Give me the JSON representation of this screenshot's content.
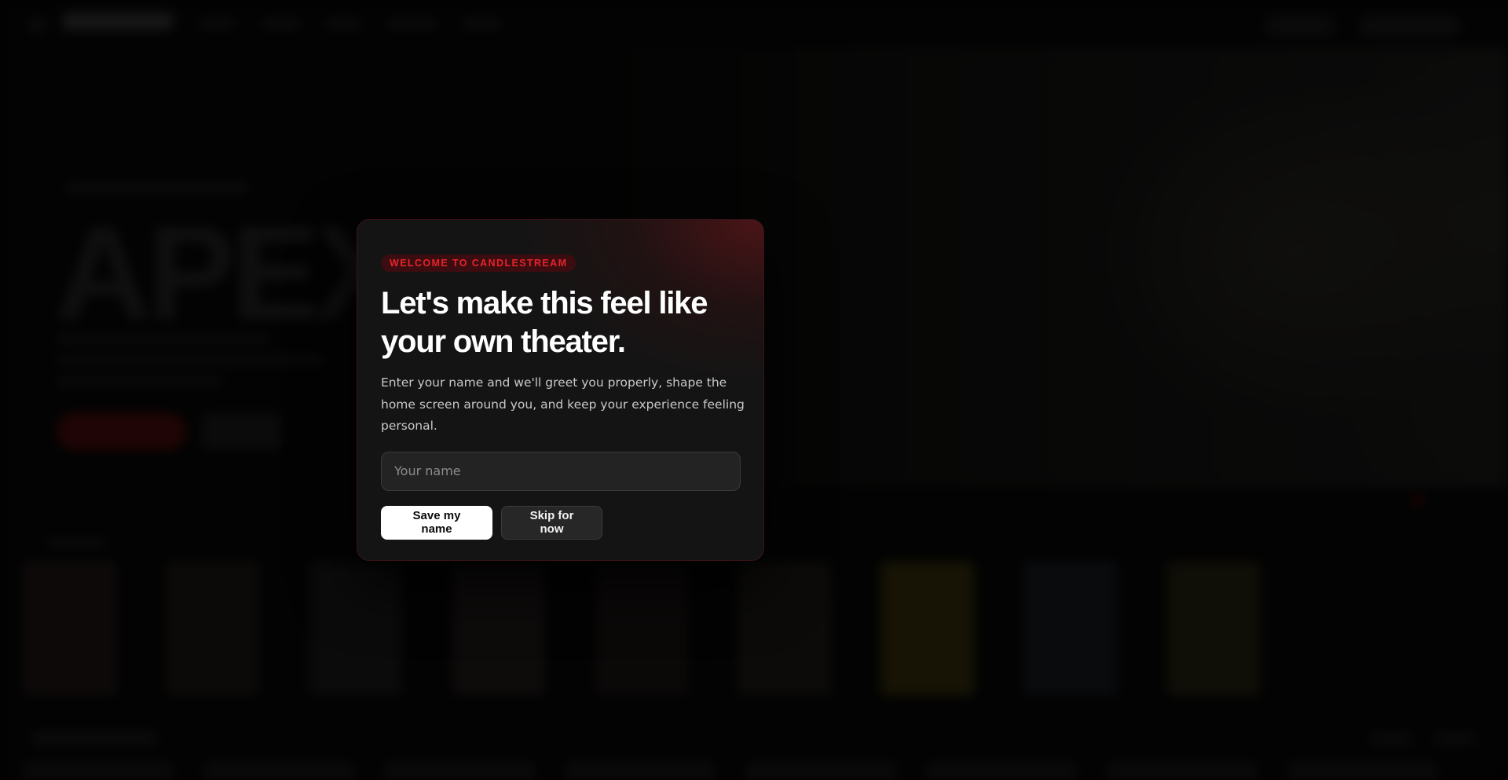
{
  "background": {
    "hero_title": "APEX"
  },
  "modal": {
    "badge": "WELCOME TO CANDLESTREAM",
    "title": "Let's make this feel like your own theater.",
    "body": "Enter your name and we'll greet you properly, shape the home screen around you, and keep your experience feeling personal.",
    "name_input": {
      "placeholder": "Your name",
      "value": ""
    },
    "primary_button": "Save my name",
    "secondary_button": "Skip for now"
  },
  "colors": {
    "accent": "#e5232b",
    "modal_background": "#141414",
    "primary_button": "#ffffff"
  }
}
